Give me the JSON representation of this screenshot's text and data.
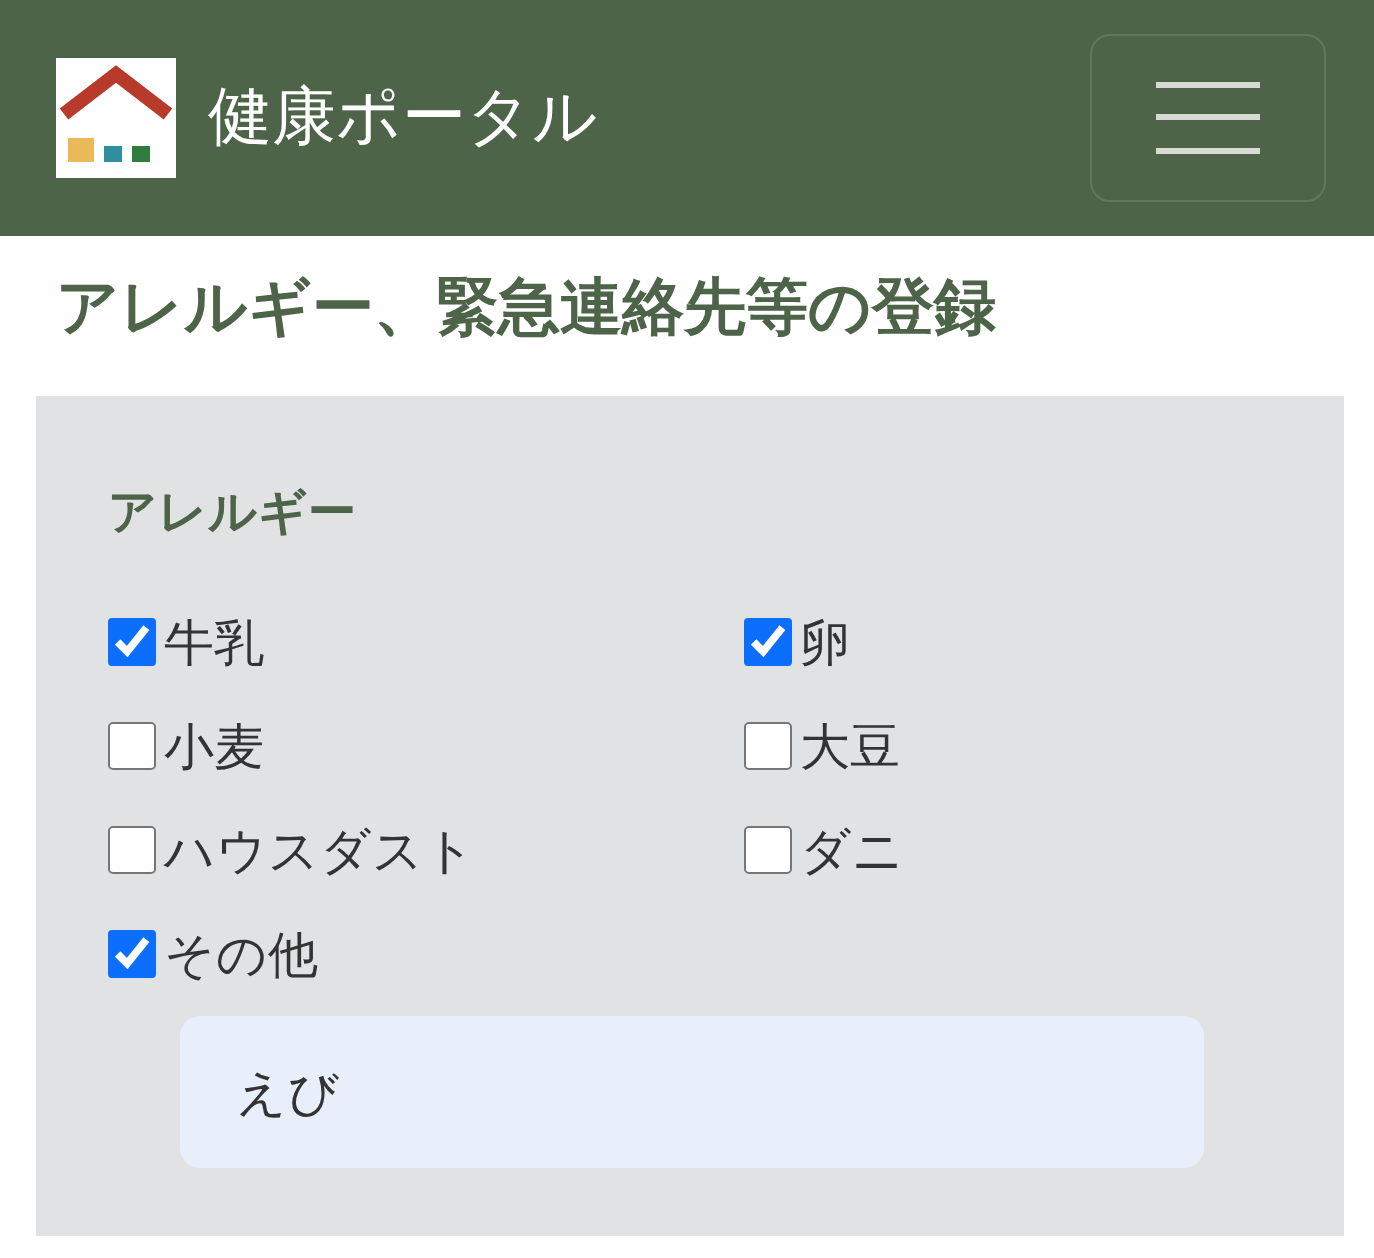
{
  "header": {
    "brand": "健康ポータル"
  },
  "page_title": "アレルギー、緊急連絡先等の登録",
  "allergy_section": {
    "heading": "アレルギー",
    "options": [
      {
        "label": "牛乳",
        "checked": true
      },
      {
        "label": "卵",
        "checked": true
      },
      {
        "label": "小麦",
        "checked": false
      },
      {
        "label": "大豆",
        "checked": false
      },
      {
        "label": "ハウスダスト",
        "checked": false
      },
      {
        "label": "ダニ",
        "checked": false
      },
      {
        "label": "その他",
        "checked": true
      }
    ],
    "other_input": {
      "value": "えび"
    }
  }
}
